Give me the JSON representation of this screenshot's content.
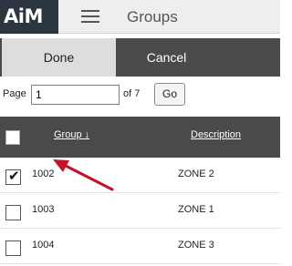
{
  "header": {
    "logo": "AiM",
    "title": "Groups"
  },
  "toolbar": {
    "done_label": "Done",
    "cancel_label": "Cancel"
  },
  "pager": {
    "page_label": "Page",
    "page_value": "1",
    "of_label": "of 7",
    "go_label": "Go"
  },
  "table": {
    "columns": {
      "group": "Group ↓",
      "description": "Description"
    },
    "rows": [
      {
        "group": "1002",
        "description": "ZONE 2",
        "checked": true
      },
      {
        "group": "1003",
        "description": "ZONE 1",
        "checked": false
      },
      {
        "group": "1004",
        "description": "ZONE 3",
        "checked": false
      }
    ]
  },
  "annotation": {
    "arrow_color": "#c0142a",
    "points_to": "1002"
  },
  "colors": {
    "dark_bar": "#4a4a4a",
    "logo_bg": "#2b3640",
    "topbar_bg": "#eeeeee"
  }
}
